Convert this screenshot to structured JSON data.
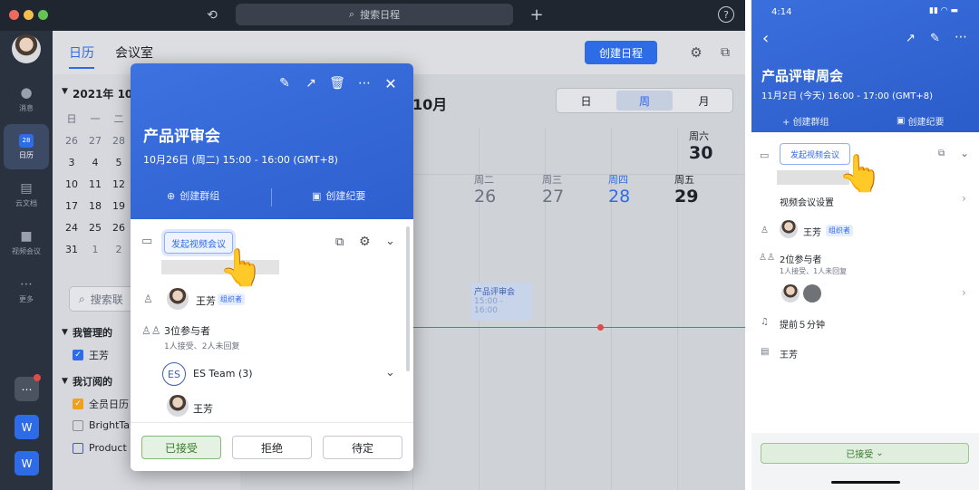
{
  "desktop": {
    "search_placeholder": "搜索日程",
    "rail": [
      {
        "label": "消息",
        "icon": "chat-icon"
      },
      {
        "label": "日历",
        "icon": "calendar-icon",
        "date": "28"
      },
      {
        "label": "云文档",
        "icon": "doc-icon"
      },
      {
        "label": "视频会议",
        "icon": "video-icon"
      },
      {
        "label": "更多",
        "icon": "more-icon"
      }
    ],
    "doc_letter": "W",
    "tabs": {
      "calendar": "日历",
      "rooms": "会议室"
    },
    "create_button": "创建日程",
    "mini_cal": {
      "month_title": "2021年 10月",
      "weekday_header": [
        "日",
        "一",
        "二"
      ],
      "rows": [
        [
          "26",
          "27",
          "28"
        ],
        [
          "3",
          "4",
          "5"
        ],
        [
          "10",
          "11",
          "12"
        ],
        [
          "17",
          "18",
          "19"
        ],
        [
          "24",
          "25",
          "26"
        ],
        [
          "31",
          "1",
          "2"
        ]
      ]
    },
    "contact_search": "搜索联",
    "managed_section": "我管理的",
    "managed_items": [
      {
        "label": "王芳",
        "color": "#2e6be6"
      }
    ],
    "subscribed_section": "我订阅的",
    "subscribed_items": [
      {
        "label": "全员日历",
        "color": "#f0a020"
      },
      {
        "label": "BrightTalk",
        "color": "#8a8f99"
      },
      {
        "label": "Product D",
        "color": "#4a50d8"
      }
    ],
    "month_label": "10月",
    "view_switch": [
      "日",
      "周",
      "月"
    ],
    "view_selected": "周",
    "days": [
      {
        "dow": "周二",
        "date": "26"
      },
      {
        "dow": "周三",
        "date": "27"
      },
      {
        "dow": "周四",
        "date": "28",
        "today": true
      },
      {
        "dow": "周五",
        "date": "29"
      },
      {
        "dow": "周六",
        "date": "30"
      }
    ],
    "grid_event": {
      "title": "产品评审会",
      "time_a": "15:00 -",
      "time_b": "16:00"
    }
  },
  "popup": {
    "title": "产品评审会",
    "time": "10月26日 (周二) 15:00 - 16:00 (GMT+8)",
    "create_group": "创建群组",
    "create_minutes": "创建纪要",
    "video_btn": "发起视频会议",
    "organizer": "王芳",
    "organizer_badge": "组织者",
    "attendee_count": "3位参与者",
    "attendee_status": "1人接受、2人未回复",
    "team_initials": "ES",
    "team": "ES Team (3)",
    "member": "王芳",
    "accept": "已接受",
    "decline": "拒绝",
    "tentative": "待定"
  },
  "phone": {
    "time": "4:14",
    "title": "产品评审周会",
    "datetime": "11月2日 (今天) 16:00 - 17:00 (GMT+8)",
    "create_group": "+ 创建群组",
    "create_minutes": "创建纪要",
    "video_btn": "发起视频会议",
    "video_settings": "视频会议设置",
    "organizer": "王芳",
    "organizer_badge": "组织者",
    "attendees": "2位参与者",
    "attendee_status": "1人接受、1人未回复",
    "reminder": "提前５分钟",
    "calendar": "王芳",
    "accepted": "已接受"
  },
  "colors": {
    "accent": "#2e6be6",
    "red_line": "#e04a4a",
    "accept_green": "#dfeedd"
  }
}
